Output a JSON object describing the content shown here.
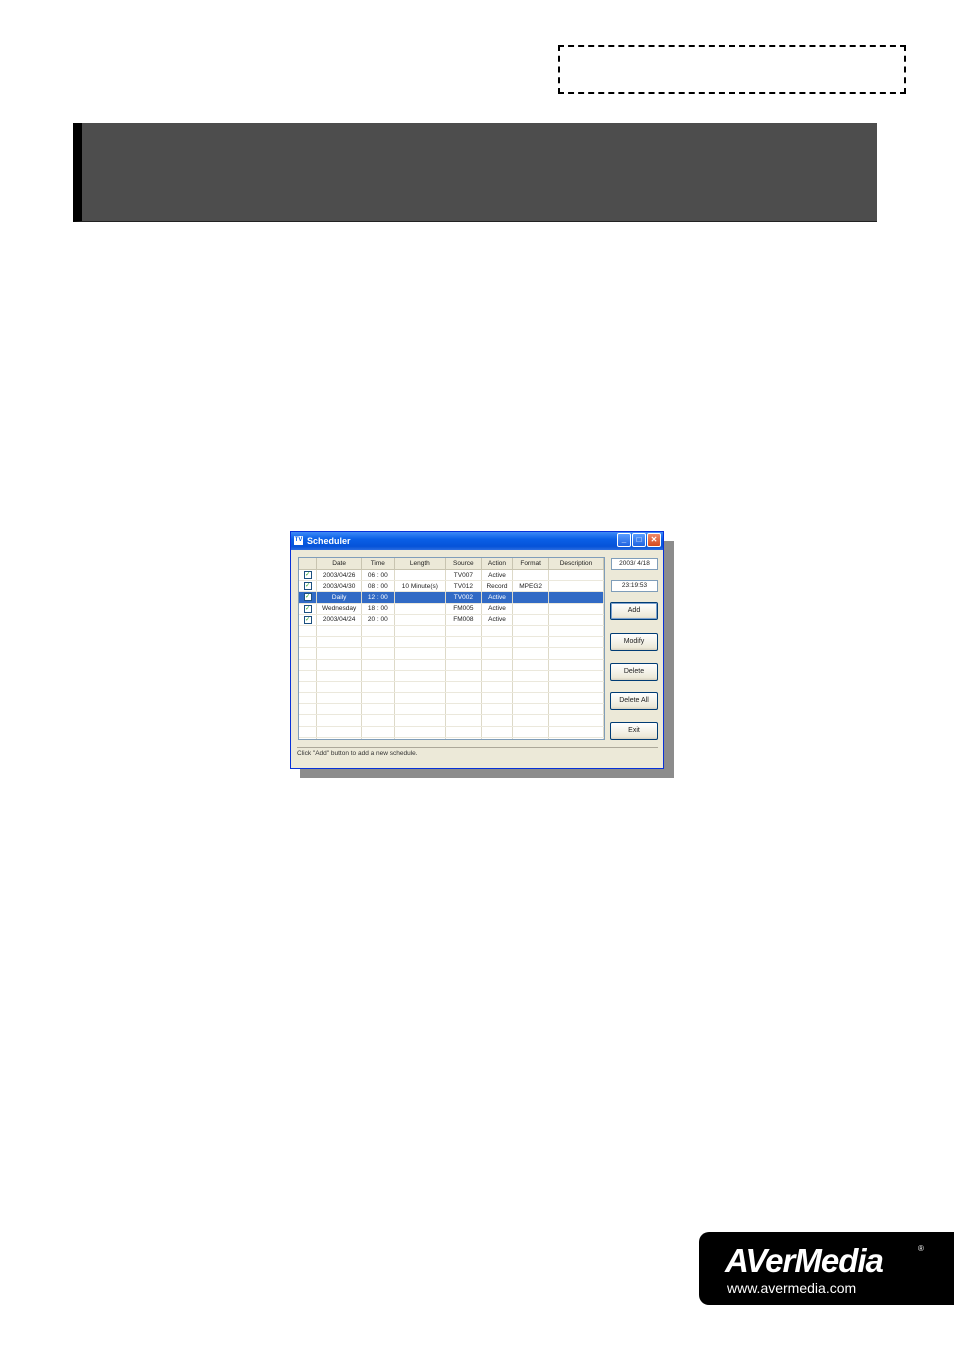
{
  "window": {
    "title": "Scheduler",
    "date_display": "2003/ 4/18",
    "time_display": "23:19:53"
  },
  "table": {
    "columns": [
      "",
      "Date",
      "Time",
      "Length",
      "Source",
      "Action",
      "Format",
      "Description"
    ],
    "rows": [
      {
        "checked": true,
        "date": "2003/04/26",
        "time": "06 : 00",
        "length": "",
        "source": "TV007",
        "action": "Active",
        "format": "",
        "description": ""
      },
      {
        "checked": true,
        "date": "2003/04/30",
        "time": "08 : 00",
        "length": "10 Minute(s)",
        "source": "TV012",
        "action": "Record",
        "format": "MPEG2",
        "description": ""
      },
      {
        "checked": true,
        "date": "Daily",
        "time": "12 : 00",
        "length": "",
        "source": "TV002",
        "action": "Active",
        "format": "",
        "description": "",
        "selected": true
      },
      {
        "checked": true,
        "date": "Wednesday",
        "time": "18 : 00",
        "length": "",
        "source": "FM005",
        "action": "Active",
        "format": "",
        "description": ""
      },
      {
        "checked": true,
        "date": "2003/04/24",
        "time": "20 : 00",
        "length": "",
        "source": "FM008",
        "action": "Active",
        "format": "",
        "description": ""
      }
    ]
  },
  "buttons": {
    "add": "Add",
    "modify": "Modify",
    "delete": "Delete",
    "delete_all": "Delete All",
    "exit": "Exit"
  },
  "status_text": "Click \"Add\" button to add a new schedule.",
  "logo": {
    "name": "AVerMedia",
    "url": "www.avermedia.com"
  },
  "colors": {
    "header_bar": "#4d4d4d",
    "selection": "#316ac5",
    "titlebar": "#0a5fe6"
  }
}
